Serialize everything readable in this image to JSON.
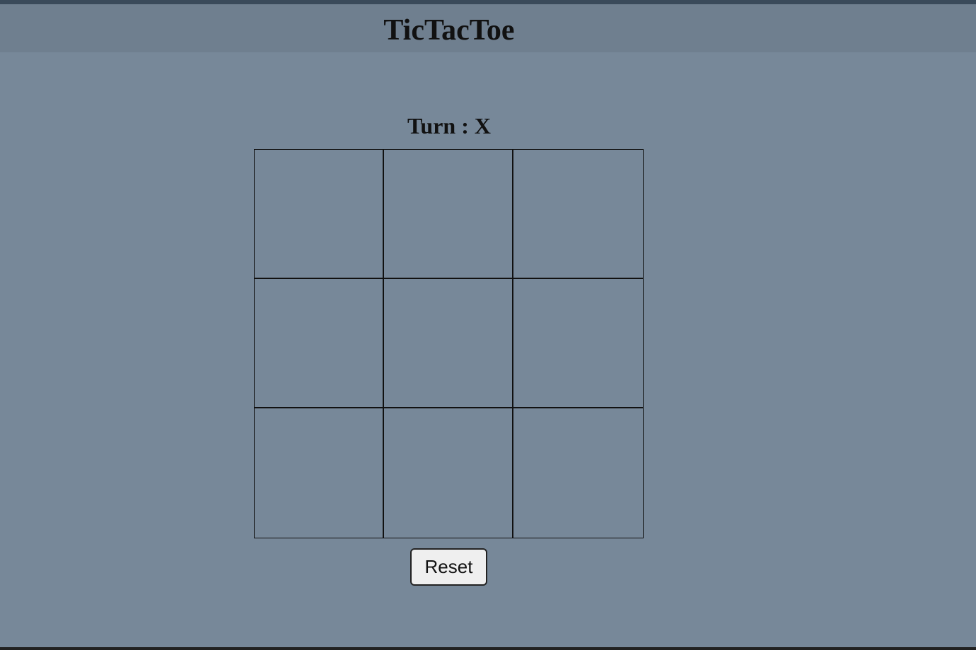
{
  "header": {
    "title": "TicTacToe"
  },
  "game": {
    "turn_text": "Turn : X",
    "cells": [
      "",
      "",
      "",
      "",
      "",
      "",
      "",
      "",
      ""
    ]
  },
  "controls": {
    "reset_label": "Reset"
  },
  "colors": {
    "background": "#778899",
    "header_background": "#6f7f8f",
    "top_strip": "#3a4a5a",
    "grid_lines": "#111111",
    "button_background": "#efefef"
  }
}
